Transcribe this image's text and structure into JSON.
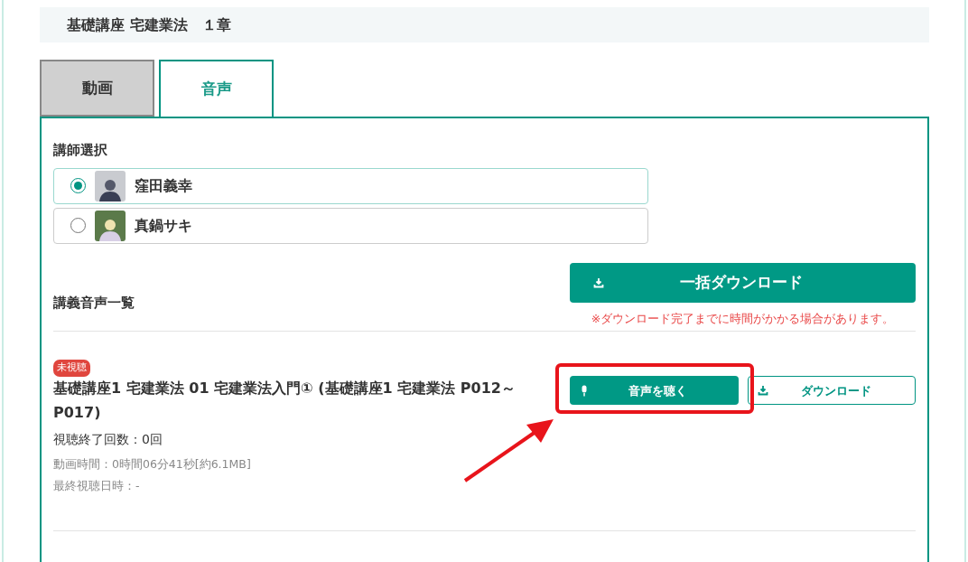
{
  "header": {
    "title": "基礎講座 宅建業法　１章"
  },
  "tabs": [
    {
      "label": "動画",
      "selected": false
    },
    {
      "label": "音声",
      "selected": true
    }
  ],
  "instructor_select": {
    "heading": "講師選択",
    "options": [
      {
        "name": "窪田義幸",
        "selected": true,
        "kind": "photo"
      },
      {
        "name": "真鍋サキ",
        "selected": false,
        "kind": "illustration"
      }
    ]
  },
  "bulk_download": {
    "label": "一括ダウンロード",
    "note": "※ダウンロード完了までに時間がかかる場合があります。"
  },
  "list_heading": "講義音声一覧",
  "lectures": [
    {
      "badge": "未視聴",
      "title": "基礎講座1 宅建業法 01 宅建業法入門① (基礎講座1 宅建業法 P012～P017)",
      "play_count": "視聴終了回数：0回",
      "duration": "動画時間：0時間06分41秒[約6.1MB]",
      "last_viewed": "最終視聴日時：-",
      "listen_label": "音声を聴く",
      "download_label": "ダウンロード",
      "highlighted": true
    }
  ]
}
